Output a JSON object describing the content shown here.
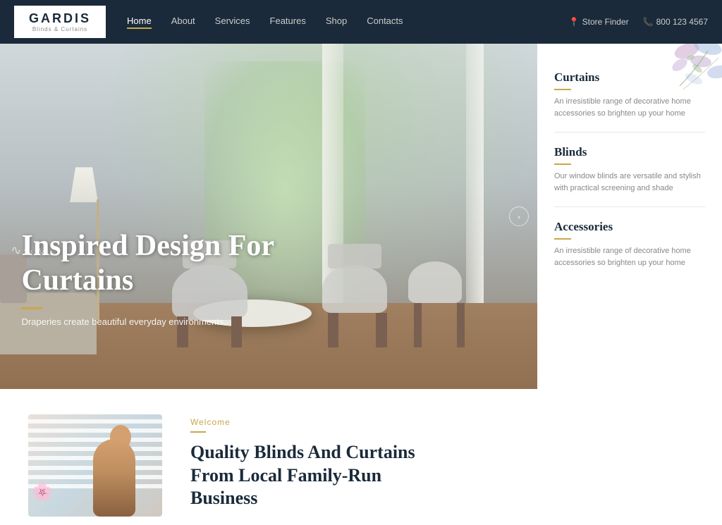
{
  "brand": {
    "name": "GARDIS",
    "subtitle": "Blinds & Curtains"
  },
  "navbar": {
    "links": [
      {
        "label": "Home",
        "active": true
      },
      {
        "label": "About",
        "active": false
      },
      {
        "label": "Services",
        "active": false
      },
      {
        "label": "Features",
        "active": false
      },
      {
        "label": "Shop",
        "active": false
      },
      {
        "label": "Contacts",
        "active": false
      }
    ],
    "store_finder": "Store Finder",
    "phone": "800 123 4567"
  },
  "hero": {
    "heading": "Inspired Design For Curtains",
    "subtext": "Draperies create beautiful everyday environments."
  },
  "side_panel": {
    "items": [
      {
        "title": "Curtains",
        "text": "An irresistible range of decorative home accessories so brighten up your home"
      },
      {
        "title": "Blinds",
        "text": "Our window blinds are versatile and stylish with practical screening and shade"
      },
      {
        "title": "Accessories",
        "text": "An irresistible range of decorative home accessories so brighten up your home"
      }
    ]
  },
  "bottom": {
    "welcome_label": "Welcome",
    "heading_line1": "Quality Blinds And Curtains",
    "heading_line2": "From Local Family-Run",
    "heading_line3": "Business"
  }
}
